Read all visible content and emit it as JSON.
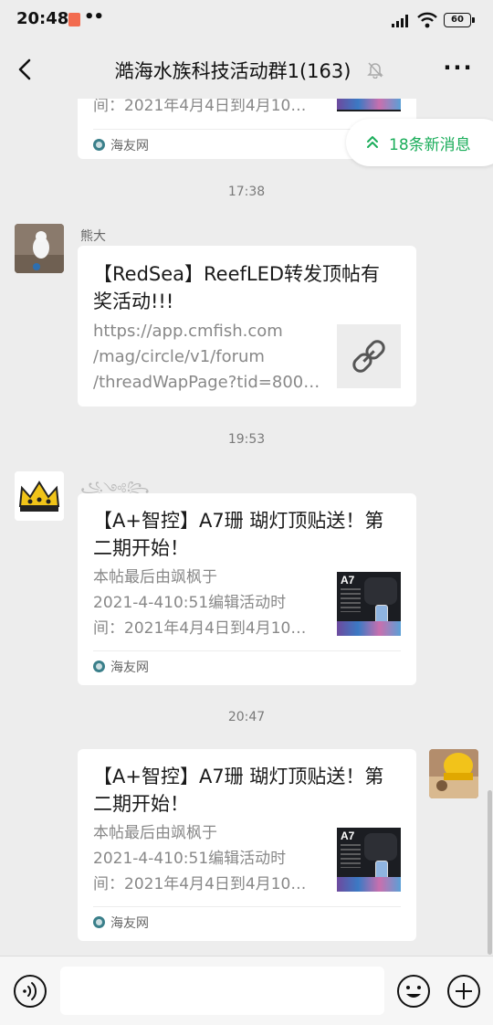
{
  "status": {
    "time": "20:48",
    "dots": "••",
    "battery": "60"
  },
  "nav": {
    "title": "澔海水族科技活动群1(163)"
  },
  "banner": {
    "new_messages": "18条新消息"
  },
  "timestamps": [
    "17:38",
    "19:53",
    "20:47"
  ],
  "messages": [
    {
      "desc": "间：2021年4月4日到4月10…",
      "source": "海友网"
    },
    {
      "sender": "熊大",
      "title": "【RedSea】ReefLED转发顶帖有奖活动!!!",
      "link": "https://app.cmfish.com\n/mag/circle/v1/forum\n/threadWapPage?tid=800…"
    },
    {
      "sender": "꧁༺꧂",
      "title": "【A+智控】A7珊 瑚灯顶贴送！第二期开始！",
      "desc": "本帖最后由飒枫于\n2021-4-410:51编辑活动时\n间：2021年4月4日到4月10…",
      "source": "海友网",
      "thumb_label": "A7"
    },
    {
      "title": "【A+智控】A7珊 瑚灯顶贴送！第二期开始！",
      "desc": "本帖最后由飒枫于\n2021-4-410:51编辑活动时\n间：2021年4月4日到4月10…",
      "source": "海友网",
      "thumb_label": "A7"
    }
  ],
  "input": {
    "placeholder": ""
  },
  "colors": {
    "background": "#ededed",
    "accent_green": "#1aad5a",
    "card": "#ffffff"
  }
}
